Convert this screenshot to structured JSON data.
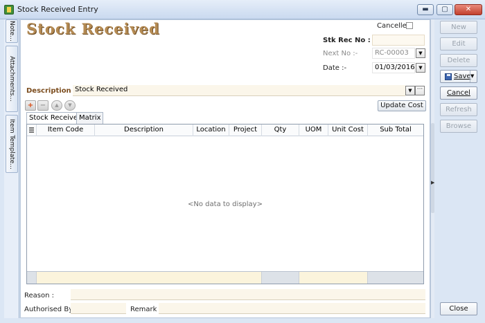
{
  "window": {
    "title": "Stock Received Entry",
    "minimize": "▬",
    "maximize": "▢",
    "close": "✕"
  },
  "side_tabs": [
    "Note...",
    "Attachments...",
    "Item Template..."
  ],
  "form": {
    "heading": "Stock Received",
    "cancelled_label": "Cancelled",
    "cancelled_checked": false,
    "stk_rec_no_label": "Stk Rec No :",
    "stk_rec_no_value": "",
    "next_no_label": "Next No :-",
    "next_no_value": "RC-00003",
    "date_label": "Date :-",
    "date_value": "01/03/2016",
    "description_label": "Description :-",
    "description_value": "Stock Received"
  },
  "toolbar": {
    "add": "+",
    "remove": "−",
    "move_up": "▲",
    "move_down": "▼",
    "update_cost": "Update Cost"
  },
  "tabs": [
    {
      "label": "Stock Received",
      "active": true
    },
    {
      "label": "Matrix",
      "active": false
    }
  ],
  "grid": {
    "columns": [
      "Item Code",
      "Description",
      "Location",
      "Project",
      "Qty",
      "UOM",
      "Unit Cost",
      "Sub Total"
    ],
    "empty_message": "<No data to display>"
  },
  "footer": {
    "reason_label": "Reason :",
    "reason_value": "",
    "authorised_label": "Authorised By :",
    "authorised_value": "",
    "remark_label": "Remark :",
    "remark_value": ""
  },
  "actions": {
    "new": "New",
    "edit": "Edit",
    "delete": "Delete",
    "save": "Save",
    "cancel": "Cancel",
    "refresh": "Refresh",
    "browse": "Browse",
    "close": "Close"
  },
  "colors": {
    "heading": "#b58b53",
    "field_bg": "#fdf9f0",
    "add_icon": "#d9480f",
    "window_bg": "#dbe6f4"
  }
}
